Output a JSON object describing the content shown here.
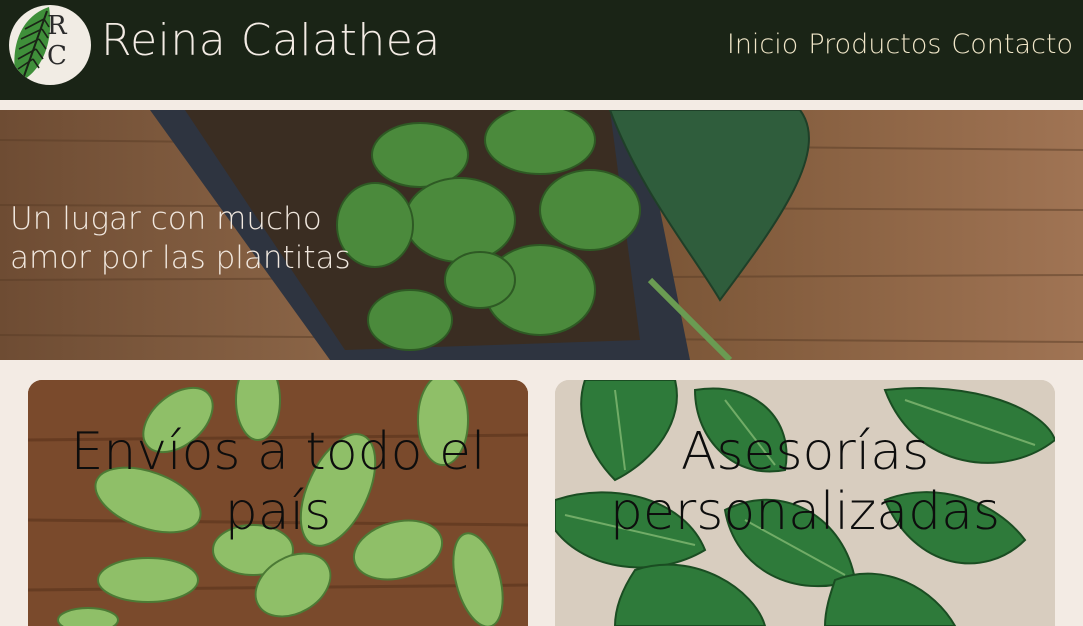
{
  "header": {
    "logo_letters": [
      "R",
      "C"
    ],
    "brand": "Reina Calathea",
    "nav": [
      {
        "label": "Inicio"
      },
      {
        "label": "Productos"
      },
      {
        "label": "Contacto"
      }
    ]
  },
  "hero": {
    "lines": [
      "Un lugar con mucho",
      "amor por las plantitas"
    ]
  },
  "cards": [
    {
      "title_lines": [
        "Envíos a todo el",
        "país"
      ]
    },
    {
      "title_lines": [
        "Asesorías",
        "personalizadas"
      ]
    }
  ],
  "colors": {
    "header_bg": "#1a2416",
    "page_bg": "#f3ebe4",
    "nav_text": "#f0e6c8",
    "leaf_green": "#4e8a3e"
  }
}
